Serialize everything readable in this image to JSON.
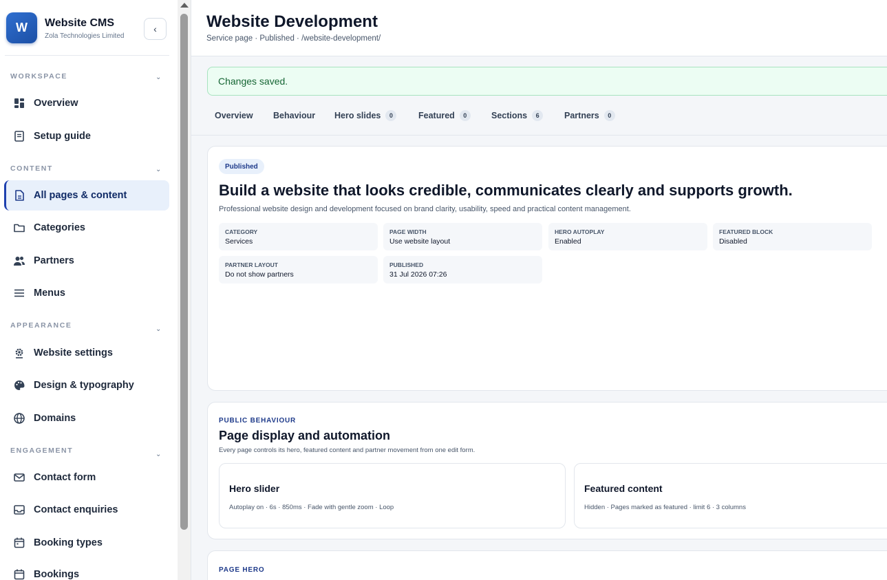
{
  "brand": {
    "logo_letter": "W",
    "name": "Website CMS",
    "company": "Zola Technologies Limited",
    "collapse_glyph": "‹"
  },
  "sidebar": {
    "sections": [
      {
        "label": "WORKSPACE",
        "chevron": "⌄"
      },
      {
        "label": "CONTENT",
        "chevron": "⌄"
      },
      {
        "label": "APPEARANCE",
        "chevron": "⌄"
      },
      {
        "label": "ENGAGEMENT",
        "chevron": "⌄"
      }
    ],
    "items": [
      {
        "label": "Overview",
        "icon": "dashboard-icon"
      },
      {
        "label": "Setup guide",
        "icon": "guide-icon"
      },
      {
        "label": "All pages & content",
        "icon": "document-icon",
        "active": true
      },
      {
        "label": "Categories",
        "icon": "folder-icon"
      },
      {
        "label": "Partners",
        "icon": "users-icon"
      },
      {
        "label": "Menus",
        "icon": "menu-icon"
      },
      {
        "label": "Website settings",
        "icon": "gear-icon"
      },
      {
        "label": "Design & typography",
        "icon": "palette-icon"
      },
      {
        "label": "Domains",
        "icon": "globe-icon"
      },
      {
        "label": "Contact form",
        "icon": "mail-icon"
      },
      {
        "label": "Contact enquiries",
        "icon": "inbox-icon"
      },
      {
        "label": "Booking types",
        "icon": "calendar-icon"
      },
      {
        "label": "Bookings",
        "icon": "calendar-check-icon"
      }
    ]
  },
  "header": {
    "title": "Website Development",
    "meta": "Service page · Published · /website-development/"
  },
  "alert": {
    "text": "Changes saved."
  },
  "tabs": [
    {
      "label": "Overview"
    },
    {
      "label": "Behaviour"
    },
    {
      "label": "Hero slides",
      "count": "0"
    },
    {
      "label": "Featured",
      "count": "0"
    },
    {
      "label": "Sections",
      "count": "6"
    },
    {
      "label": "Partners",
      "count": "0"
    }
  ],
  "hero_card": {
    "status": "Published",
    "title": "Build a website that looks credible, communicates clearly and supports growth.",
    "description": "Professional website design and development focused on brand clarity, usability, speed and practical content management.",
    "fields": [
      {
        "key": "CATEGORY",
        "value": "Services"
      },
      {
        "key": "PAGE WIDTH",
        "value": "Use website layout"
      },
      {
        "key": "HERO AUTOPLAY",
        "value": "Enabled"
      },
      {
        "key": "FEATURED BLOCK",
        "value": "Disabled"
      },
      {
        "key": "PARTNER LAYOUT",
        "value": "Do not show partners"
      },
      {
        "key": "PUBLISHED",
        "value": "31 Jul 2026 07:26"
      }
    ]
  },
  "behaviour_card": {
    "eyebrow": "PUBLIC BEHAVIOUR",
    "title": "Page display and automation",
    "description": "Every page controls its hero, featured content and partner movement from one edit form.",
    "blocks": [
      {
        "title": "Hero slider",
        "summary": "Autoplay on · 6s · 850ms · Fade with gentle zoom · Loop"
      },
      {
        "title": "Featured content",
        "summary": "Hidden · Pages marked as featured · limit 6 · 3 columns"
      }
    ]
  },
  "page_hero_card": {
    "eyebrow": "PAGE HERO"
  },
  "colors": {
    "accent": "#1e40af",
    "active_bg": "#e8f0fb",
    "success_bg": "#ecfdf3",
    "success_text": "#166534"
  }
}
